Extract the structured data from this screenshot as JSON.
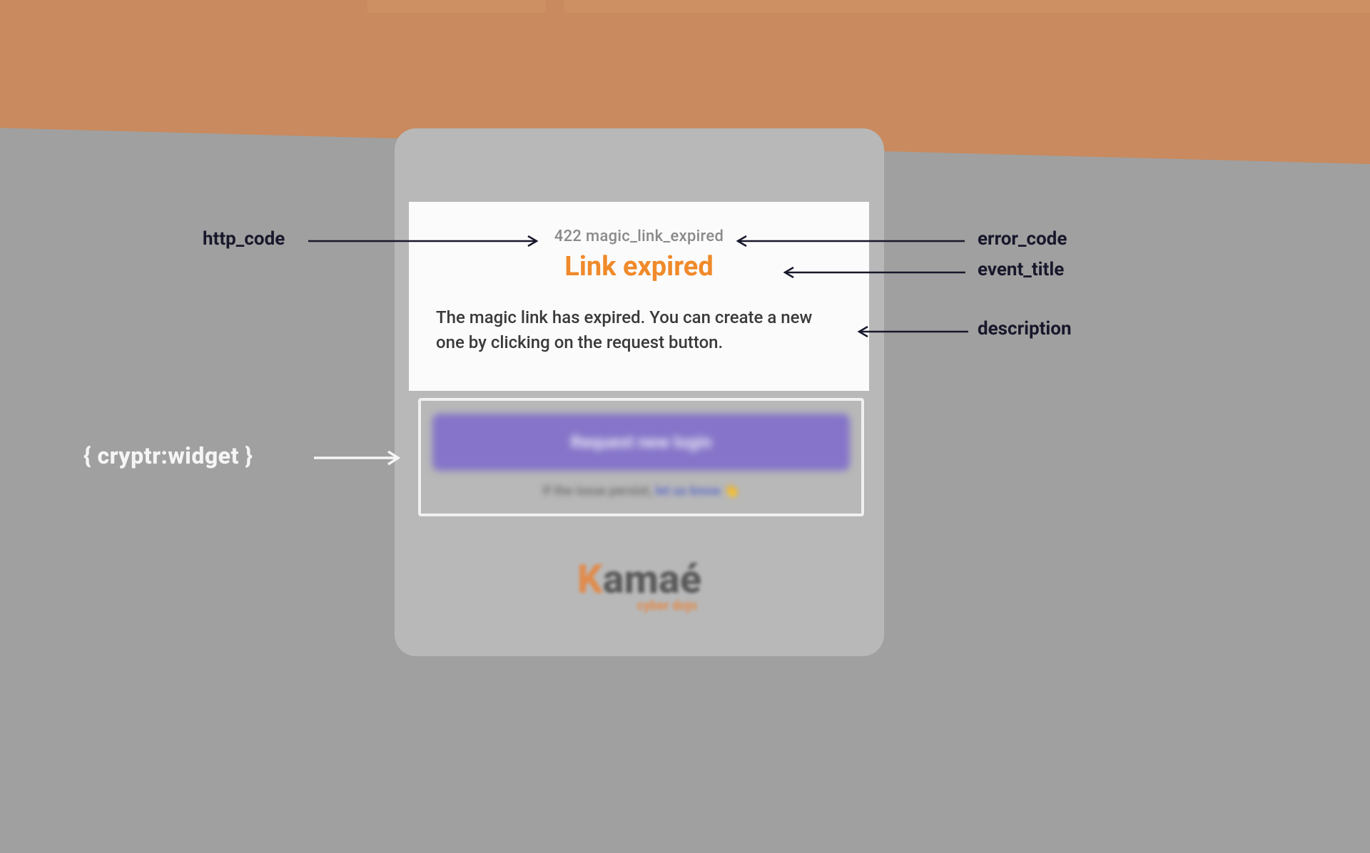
{
  "annotations": {
    "http_code": "http_code",
    "error_code": "error_code",
    "event_title": "event_title",
    "description": "description",
    "widget": "{ cryptr:widget }"
  },
  "error_panel": {
    "http_code": "422",
    "error_code": "magic_link_expired",
    "event_title": "Link expired",
    "description": "The magic link has expired. You can create a new one by clicking on the request button."
  },
  "widget": {
    "button_label": "Request new login",
    "persist_text": "If the issue persist,",
    "persist_link": "let us know",
    "persist_emoji": "👋"
  },
  "branding": {
    "logo_text": "Kamaé",
    "logo_subtitle": "cyber dojo"
  },
  "colors": {
    "accent_orange": "#f08a2a",
    "button_purple": "#8574c9",
    "text_dark": "#18182c"
  }
}
